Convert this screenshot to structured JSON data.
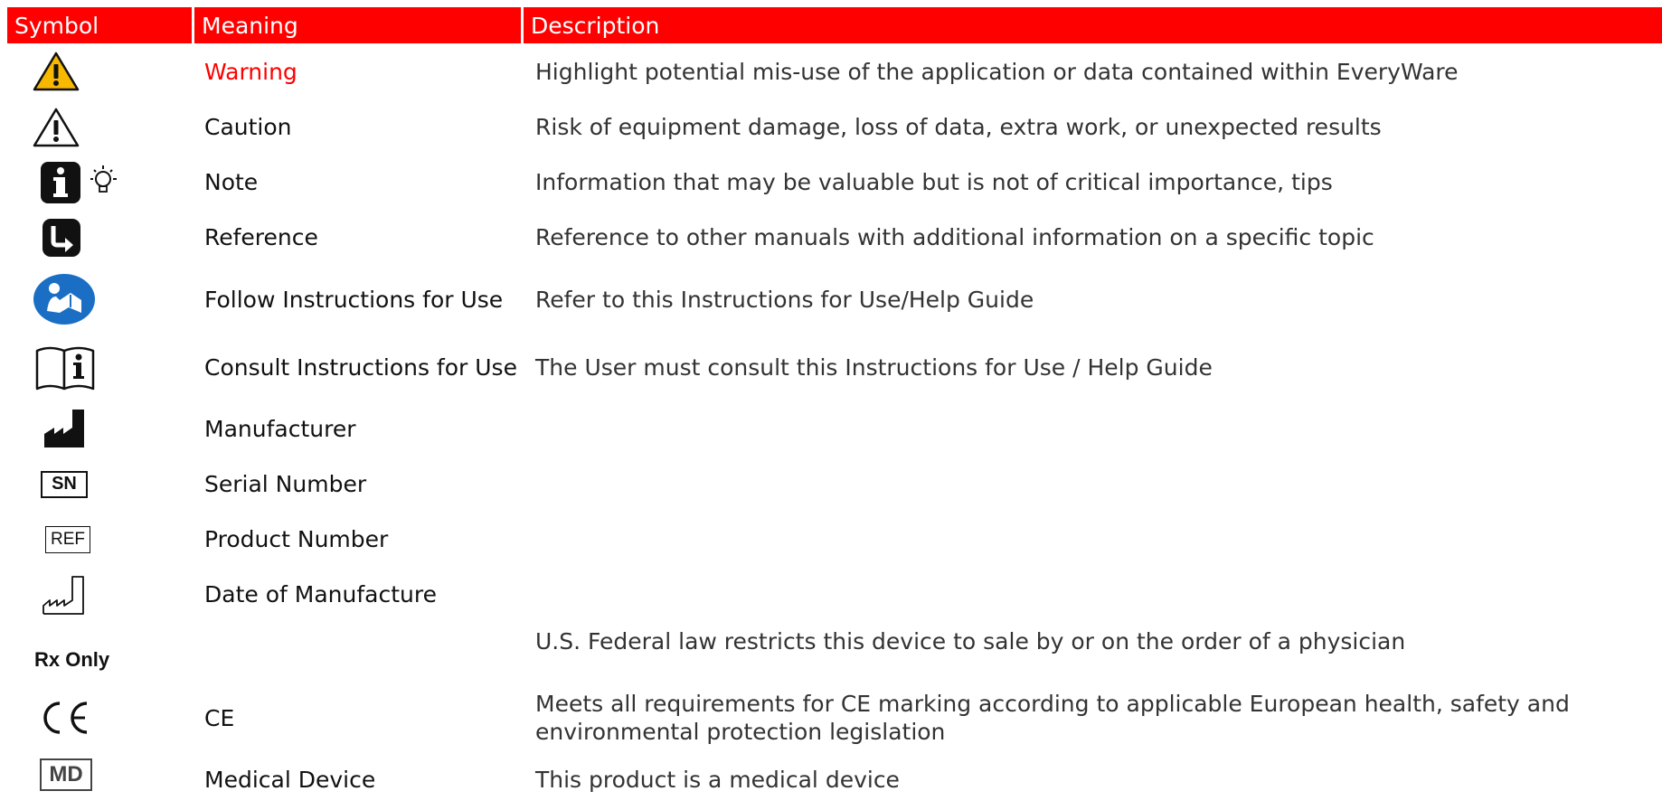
{
  "header": {
    "symbol": "Symbol",
    "meaning": "Meaning",
    "description": "Description"
  },
  "rows": [
    {
      "icon": "warning-yellow-icon",
      "meaning": "Warning",
      "description": "Highlight potential mis-use of the application or data contained within EveryWare"
    },
    {
      "icon": "caution-triangle-icon",
      "meaning": "Caution",
      "description": "Risk of equipment damage, loss of data, extra work, or unexpected results"
    },
    {
      "icon": "info-lightbulb-icon",
      "meaning": "Note",
      "description": "Information that may be valuable but is not of critical importance, tips"
    },
    {
      "icon": "reference-arrow-icon",
      "meaning": "Reference",
      "description": "Reference to other manuals with additional information on a specific topic"
    },
    {
      "icon": "follow-instructions-icon",
      "meaning": "Follow Instructions for Use",
      "description": "Refer to this Instructions for Use/Help Guide"
    },
    {
      "icon": "consult-instructions-icon",
      "meaning": "Consult Instructions for Use",
      "description": "The User must consult this Instructions for Use / Help Guide"
    },
    {
      "icon": "manufacturer-icon",
      "meaning": "Manufacturer",
      "description": ""
    },
    {
      "icon": "serial-number-icon",
      "meaning": "Serial Number",
      "description": "",
      "icon_text": "SN"
    },
    {
      "icon": "product-number-icon",
      "meaning": "Product Number",
      "description": "",
      "icon_text": "REF"
    },
    {
      "icon": "date-of-manufacture-icon",
      "meaning": "Date of Manufacture",
      "description": ""
    },
    {
      "icon": "rx-only-icon",
      "meaning": "",
      "description": "U.S. Federal law restricts this device to sale by or on the order of a physician",
      "icon_text": "Rx Only"
    },
    {
      "icon": "ce-mark-icon",
      "meaning": "CE",
      "description": "Meets all requirements for CE marking according to applicable European health, safety and environmental protection legislation"
    },
    {
      "icon": "medical-device-icon",
      "meaning": "Medical Device",
      "description": "This product is a medical device",
      "icon_text": "MD"
    }
  ],
  "colors": {
    "header_bg": "#ff0000",
    "warning_text": "#ff0000",
    "warning_icon_fill": "#f7b800",
    "follow_icon_blue": "#1a6fc4"
  }
}
